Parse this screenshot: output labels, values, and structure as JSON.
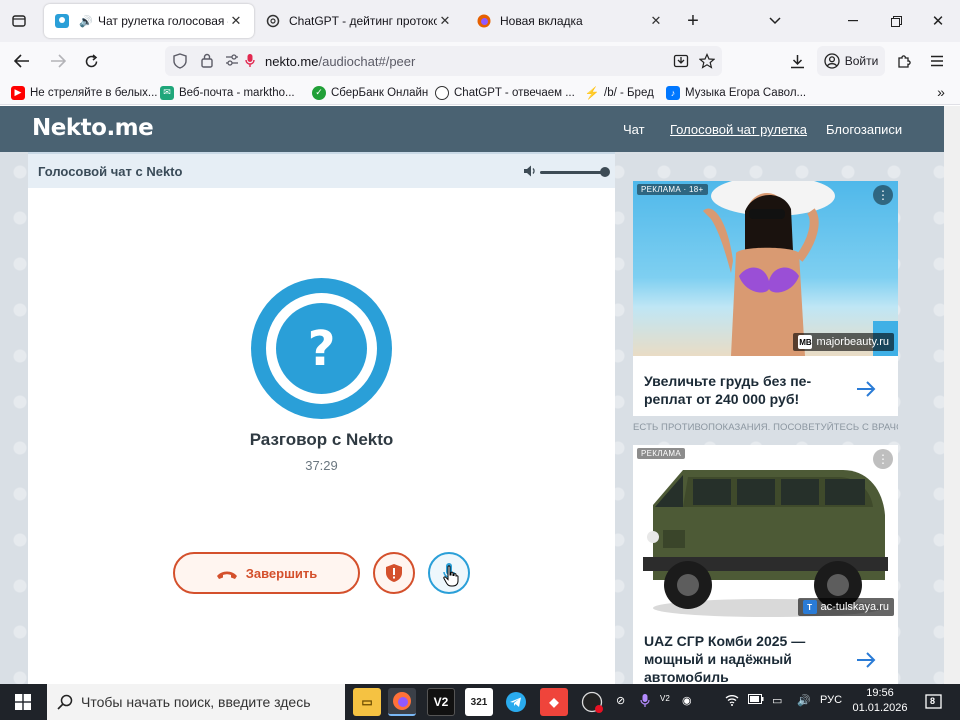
{
  "browser": {
    "tabs": [
      {
        "title": "Чат рулетка голосовая — ",
        "active": true
      },
      {
        "title": "ChatGPT - дейтинг протокол",
        "active": false
      },
      {
        "title": "Новая вкладка",
        "active": false
      }
    ],
    "url_host": "nekto.me",
    "url_path": "/audiochat#/peer",
    "signin_label": "Войти",
    "bookmarks": [
      {
        "label": "Не стреляйте в белых..."
      },
      {
        "label": "Веб-почта - markthо..."
      },
      {
        "label": "СберБанк Онлайн"
      },
      {
        "label": "ChatGPT - отвечаем ..."
      },
      {
        "label": "/b/ - Бред"
      },
      {
        "label": "Музыка Егора Савол..."
      }
    ]
  },
  "site": {
    "logo": "Nekto.me",
    "nav": [
      {
        "label": "Чат"
      },
      {
        "label": "Голосовой чат рулетка"
      },
      {
        "label": "Блогозаписи"
      }
    ]
  },
  "chat": {
    "panel_title": "Голосовой чат с Nekto",
    "avatar_symbol": "?",
    "call_name": "Разговор с Nekto",
    "timer": "37:29",
    "end_label": "Завершить",
    "report_symbol": "!",
    "volume_level": 1.0
  },
  "ads": [
    {
      "label": "РЕКЛАМА · 18+",
      "source": "majorbeauty.ru",
      "source_icon": "MB",
      "text_line1": "Увеличьте грудь без пе-",
      "text_line2": "реплат от 240 000 руб!"
    },
    {
      "label": "РЕКЛАМА",
      "source": "ac-tulskaya.ru",
      "source_icon": "T",
      "text_line1": "UAZ СГР Комби 2025 —",
      "text_line2": "мощный и надёжный",
      "text_line3": "автомобиль"
    }
  ],
  "disclaimer": "ЕСТЬ ПРОТИВОПОКАЗАНИЯ. ПОСОВЕТУЙТЕСЬ С ВРАЧОМ",
  "taskbar": {
    "search_placeholder": "Чтобы начать поиск, введите здесь",
    "lang": "РУС",
    "time": "19:56",
    "date": "01.01.2026",
    "notifications": "8"
  },
  "colors": {
    "header": "#4a6272",
    "accent_blue": "#2a9fd8",
    "accent_red": "#d4502c"
  }
}
